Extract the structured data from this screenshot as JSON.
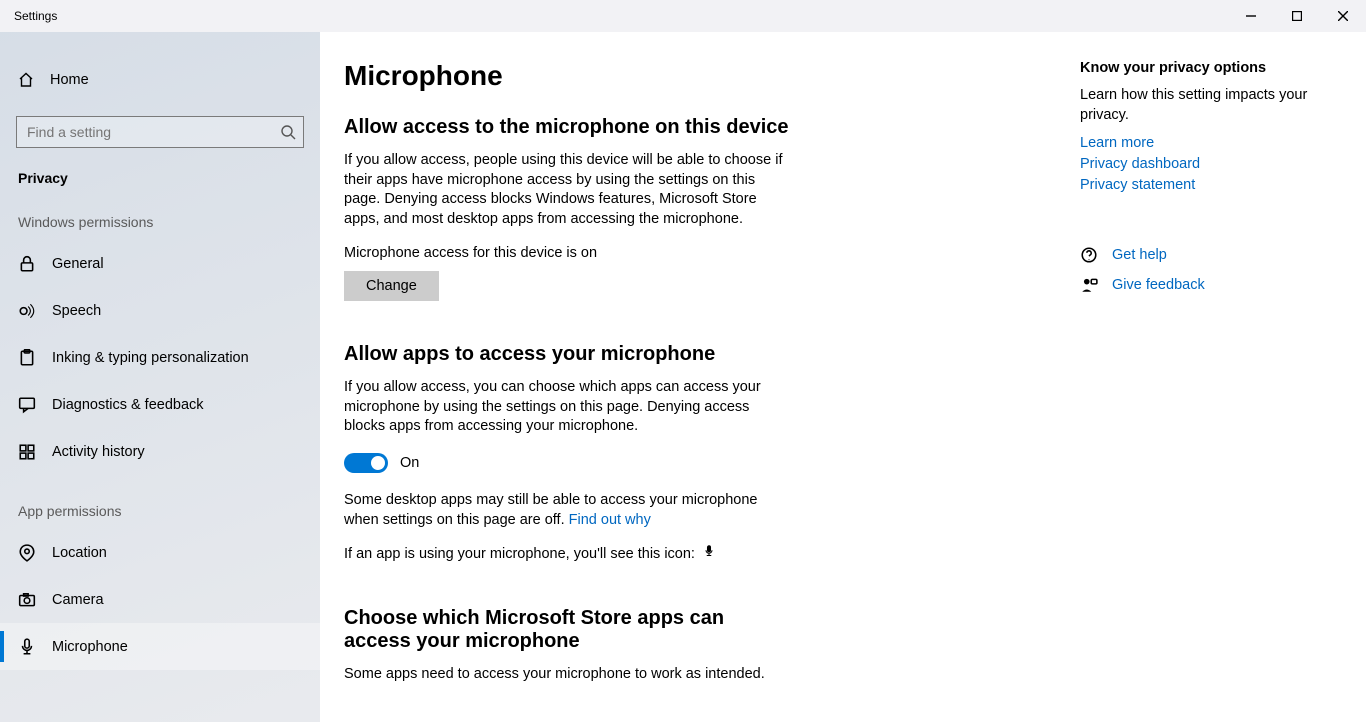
{
  "window": {
    "title": "Settings"
  },
  "sidebar": {
    "home": "Home",
    "search_placeholder": "Find a setting",
    "category": "Privacy",
    "group_windows": "Windows permissions",
    "group_app": "App permissions",
    "windows_items": [
      {
        "label": "General"
      },
      {
        "label": "Speech"
      },
      {
        "label": "Inking & typing personalization"
      },
      {
        "label": "Diagnostics & feedback"
      },
      {
        "label": "Activity history"
      }
    ],
    "app_items": [
      {
        "label": "Location"
      },
      {
        "label": "Camera"
      },
      {
        "label": "Microphone"
      }
    ]
  },
  "page": {
    "title": "Microphone",
    "s1_title": "Allow access to the microphone on this device",
    "s1_desc": "If you allow access, people using this device will be able to choose if their apps have microphone access by using the settings on this page. Denying access blocks Windows features, Microsoft Store apps, and most desktop apps from accessing the microphone.",
    "s1_status": "Microphone access for this device is on",
    "s1_button": "Change",
    "s2_title": "Allow apps to access your microphone",
    "s2_desc": "If you allow access, you can choose which apps can access your microphone by using the settings on this page. Denying access blocks apps from accessing your microphone.",
    "toggle_state": "On",
    "s2_note_a": "Some desktop apps may still be able to access your microphone when settings on this page are off. ",
    "s2_note_link": "Find out why",
    "s2_icon_line": "If an app is using your microphone, you'll see this icon:",
    "s3_title": "Choose which Microsoft Store apps can access your microphone",
    "s3_desc": "Some apps need to access your microphone to work as intended."
  },
  "aside": {
    "title": "Know your privacy options",
    "desc": "Learn how this setting impacts your privacy.",
    "links": [
      "Learn more",
      "Privacy dashboard",
      "Privacy statement"
    ],
    "help": "Get help",
    "feedback": "Give feedback"
  }
}
